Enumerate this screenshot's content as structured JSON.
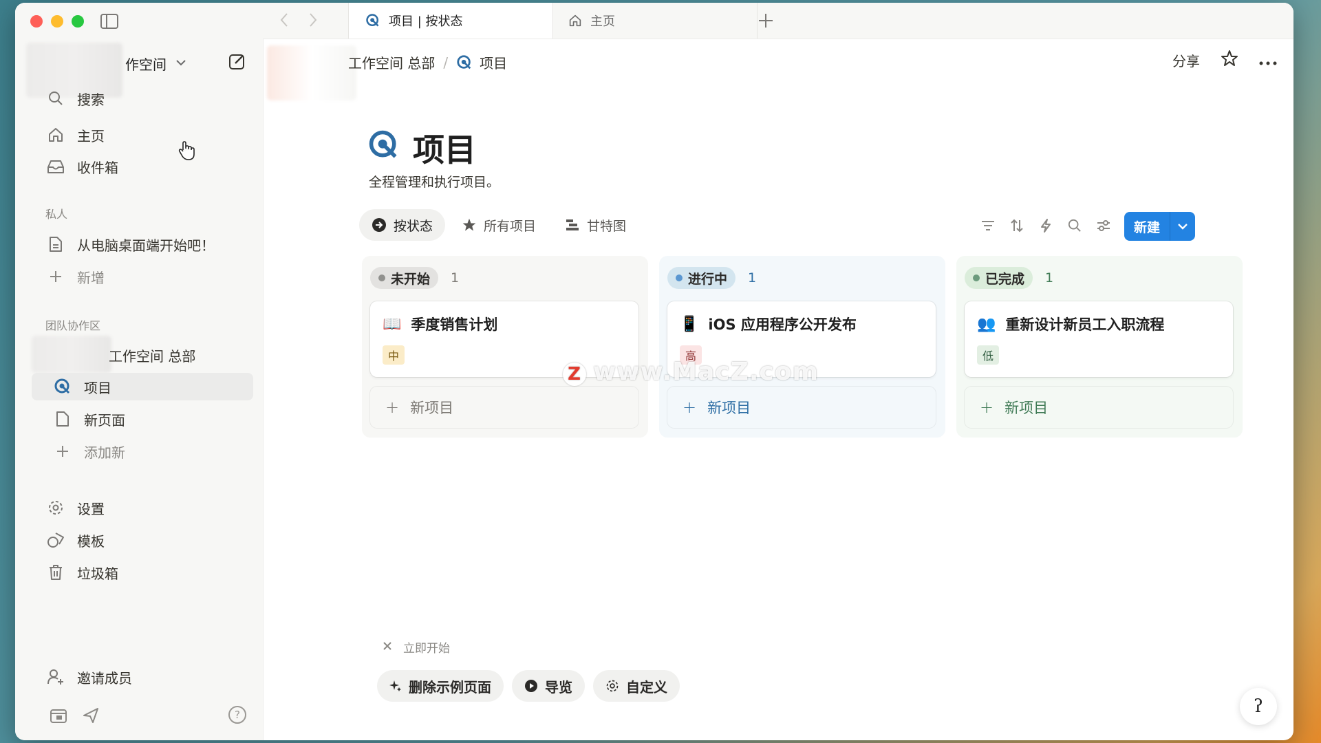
{
  "tabs": [
    {
      "label": "项目 | 按状态",
      "active": true
    },
    {
      "label": "主页",
      "active": false
    }
  ],
  "sidebar": {
    "workspace_name": "作空间",
    "nav": {
      "search": "搜索",
      "home": "主页",
      "inbox": "收件箱"
    },
    "private_label": "私人",
    "private_items": [
      {
        "label": "从电脑桌面端开始吧！"
      }
    ],
    "private_add": "新增",
    "team_label": "团队协作区",
    "team_workspace": "工作空间 总部",
    "team_items": [
      {
        "label": "项目"
      },
      {
        "label": "新页面"
      }
    ],
    "team_add": "添加新",
    "settings": "设置",
    "templates": "模板",
    "trash": "垃圾箱",
    "invite": "邀请成员",
    "help_glyph": "?"
  },
  "breadcrumb": {
    "workspace": "工作空间 总部",
    "page": "项目"
  },
  "topbar": {
    "share": "分享"
  },
  "page": {
    "title": "项目",
    "description": "全程管理和执行项目。"
  },
  "views": [
    {
      "label": "按状态",
      "icon": "arrow-circle-icon"
    },
    {
      "label": "所有项目",
      "icon": "star-icon"
    },
    {
      "label": "甘特图",
      "icon": "gantt-icon"
    }
  ],
  "new_button": {
    "label": "新建"
  },
  "board": {
    "add_label": "新项目",
    "columns": [
      {
        "name": "未开始",
        "count": "1",
        "dot": "#91918e",
        "pill_bg": "#e3e2e0",
        "col_bg": "#f7f7f5",
        "add_color": "#7d7a75",
        "card": {
          "emoji": "📖",
          "title": "季度销售计划",
          "tag": "中",
          "tag_bg": "#fbecc8",
          "tag_color": "#7a5a12"
        }
      },
      {
        "name": "进行中",
        "count": "1",
        "dot": "#5b97d1",
        "pill_bg": "#d3e5ef",
        "col_bg": "#f3f8fb",
        "add_color": "#2f6fa5",
        "card": {
          "emoji": "📱",
          "title": "iOS 应用程序公开发布",
          "tag": "高",
          "tag_bg": "#fbe4e4",
          "tag_color": "#8e3030"
        }
      },
      {
        "name": "已完成",
        "count": "1",
        "dot": "#6c9b7d",
        "pill_bg": "#dbeddb",
        "col_bg": "#f4f9f4",
        "add_color": "#3f7a55",
        "card": {
          "emoji": "👥",
          "title": "重新设计新员工入职流程",
          "tag": "低",
          "tag_bg": "#e3efe3",
          "tag_color": "#2f5c3f"
        }
      }
    ]
  },
  "watermark": {
    "badge": "Z",
    "text": "www.MacZ.com"
  },
  "get_started": {
    "label": "立即开始",
    "buttons": [
      {
        "label": "删除示例页面",
        "icon": "sparkle-icon"
      },
      {
        "label": "导览",
        "icon": "play-icon"
      },
      {
        "label": "自定义",
        "icon": "gear-icon"
      }
    ]
  },
  "fab_glyph": "ʔ"
}
